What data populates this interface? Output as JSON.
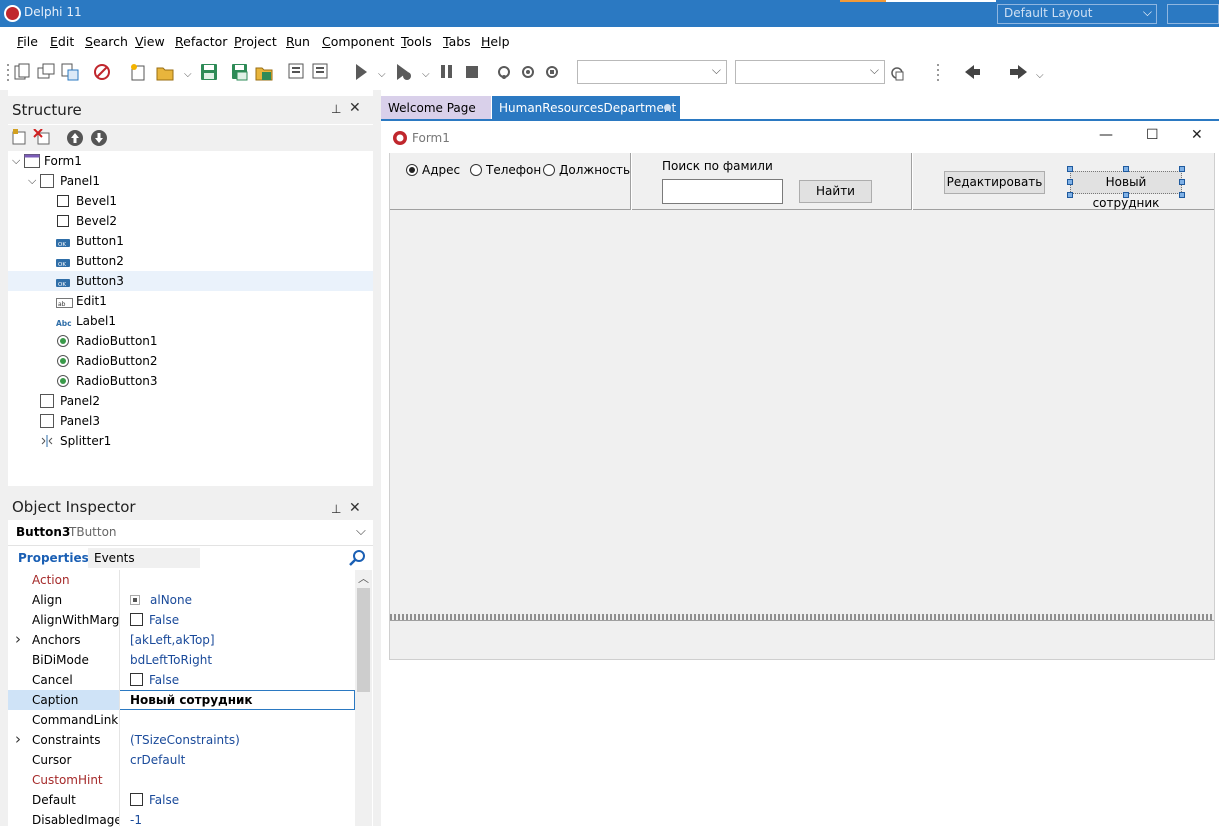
{
  "window": {
    "title": "Delphi 11",
    "layout_combo": "Default Layout"
  },
  "menu": [
    {
      "label": "File",
      "ul": "F",
      "rest": "ile"
    },
    {
      "label": "Edit",
      "ul": "E",
      "rest": "dit"
    },
    {
      "label": "Search",
      "ul": "S",
      "rest": "earch"
    },
    {
      "label": "View",
      "ul": "V",
      "rest": "iew"
    },
    {
      "label": "Refactor",
      "ul": "R",
      "rest": "efactor"
    },
    {
      "label": "Project",
      "ul": "P",
      "rest": "roject"
    },
    {
      "label": "Run",
      "ul": "R",
      "rest": "un"
    },
    {
      "label": "Component",
      "ul": "C",
      "rest": "omponent"
    },
    {
      "label": "Tools",
      "ul": "T",
      "rest": "ools"
    },
    {
      "label": "Tabs",
      "ul": "T",
      "rest": "abs"
    },
    {
      "label": "Help",
      "ul": "H",
      "rest": "elp"
    }
  ],
  "structure": {
    "title": "Structure",
    "items": [
      {
        "label": "Form1",
        "depth": 0,
        "icon": "form-icon",
        "expand": "open"
      },
      {
        "label": "Panel1",
        "depth": 1,
        "icon": "panel-icon",
        "expand": "open"
      },
      {
        "label": "Bevel1",
        "depth": 2,
        "icon": "bevel-icon"
      },
      {
        "label": "Bevel2",
        "depth": 2,
        "icon": "bevel-icon"
      },
      {
        "label": "Button1",
        "depth": 2,
        "icon": "button-icon"
      },
      {
        "label": "Button2",
        "depth": 2,
        "icon": "button-icon"
      },
      {
        "label": "Button3",
        "depth": 2,
        "icon": "button-icon",
        "selected": true
      },
      {
        "label": "Edit1",
        "depth": 2,
        "icon": "edit-icon"
      },
      {
        "label": "Label1",
        "depth": 2,
        "icon": "label-icon"
      },
      {
        "label": "RadioButton1",
        "depth": 2,
        "icon": "radio-icon"
      },
      {
        "label": "RadioButton2",
        "depth": 2,
        "icon": "radio-icon"
      },
      {
        "label": "RadioButton3",
        "depth": 2,
        "icon": "radio-icon"
      },
      {
        "label": "Panel2",
        "depth": 1,
        "icon": "panel-icon"
      },
      {
        "label": "Panel3",
        "depth": 1,
        "icon": "panel-icon"
      },
      {
        "label": "Splitter1",
        "depth": 1,
        "icon": "splitter-icon"
      }
    ]
  },
  "inspector": {
    "title": "Object Inspector",
    "object_name": "Button3",
    "object_type": "TButton",
    "tab_properties": "Properties",
    "tab_events": "Events",
    "rows": [
      {
        "name": "Action",
        "value": "",
        "color": "#a52a2a"
      },
      {
        "name": "Align",
        "value": "alNone",
        "icon": "align"
      },
      {
        "name": "AlignWithMargins",
        "value": "False",
        "cb": true
      },
      {
        "name": "Anchors",
        "value": "[akLeft,akTop]",
        "expand": true
      },
      {
        "name": "BiDiMode",
        "value": "bdLeftToRight"
      },
      {
        "name": "Cancel",
        "value": "False",
        "cb": true
      },
      {
        "name": "Caption",
        "value": "Новый сотрудник",
        "selected": true
      },
      {
        "name": "CommandLinkHint",
        "value": ""
      },
      {
        "name": "Constraints",
        "value": "(TSizeConstraints)",
        "expand": true
      },
      {
        "name": "Cursor",
        "value": "crDefault"
      },
      {
        "name": "CustomHint",
        "value": "",
        "color": "#a52a2a"
      },
      {
        "name": "Default",
        "value": "False",
        "cb": true
      },
      {
        "name": "DisabledImageIndex",
        "value": "-1"
      }
    ]
  },
  "tabs": {
    "welcome": "Welcome Page",
    "active": "HumanResourcesDepartment"
  },
  "form": {
    "title": "Form1",
    "radios": [
      {
        "label": "Адрес",
        "checked": true
      },
      {
        "label": "Телефон",
        "checked": false
      },
      {
        "label": "Должность",
        "checked": false
      }
    ],
    "search_label": "Поиск по фамили",
    "search_value": "",
    "find_button": "Найти",
    "edit_button": "Редактировать",
    "new_button": "Новый сотрудник"
  }
}
